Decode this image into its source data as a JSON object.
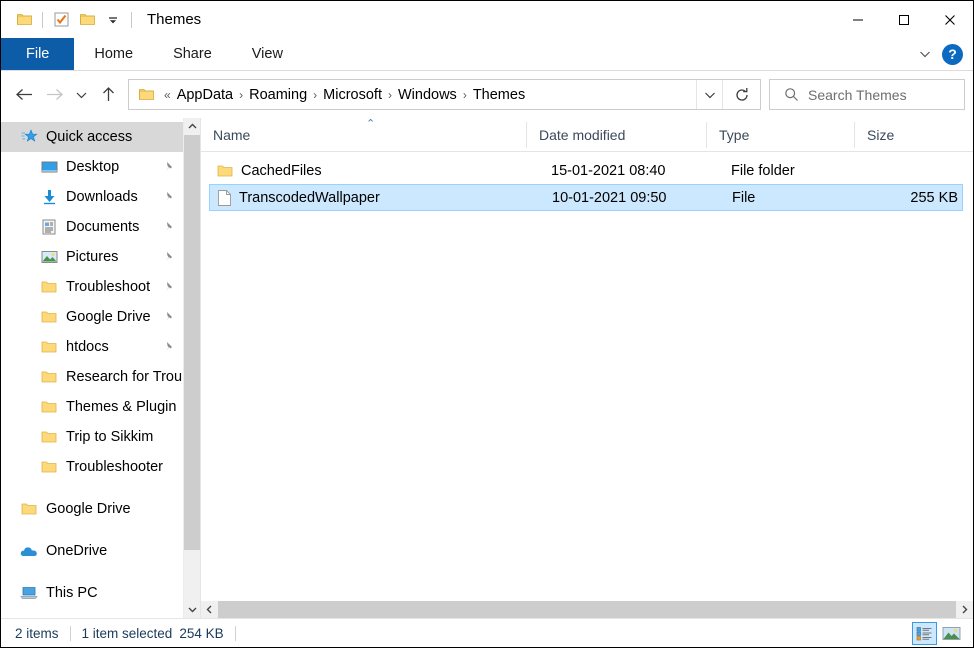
{
  "window": {
    "title": "Themes",
    "quick_access_toolbar": [
      {
        "name": "folder-icon",
        "label": "Properties"
      },
      {
        "name": "checkbox-icon",
        "label": "New folder"
      },
      {
        "name": "folder-icon",
        "label": "Folder"
      },
      {
        "name": "chevron-down-icon",
        "label": "Customize Quick Access Toolbar"
      }
    ],
    "controls": {
      "minimize": "Minimize",
      "maximize": "Maximize",
      "close": "Close"
    }
  },
  "ribbon": {
    "tabs": [
      {
        "label": "File",
        "active": true
      },
      {
        "label": "Home",
        "active": false
      },
      {
        "label": "Share",
        "active": false
      },
      {
        "label": "View",
        "active": false
      }
    ],
    "expand_label": "Expand the Ribbon",
    "help_label": "?"
  },
  "navigation": {
    "back": "Back",
    "forward": "Forward",
    "recent": "Recent locations",
    "up": "Up",
    "folder_icon": "folder-icon",
    "overflow": "«",
    "breadcrumbs": [
      "AppData",
      "Roaming",
      "Microsoft",
      "Windows",
      "Themes"
    ],
    "separator": "›",
    "dropdown": "Previous Locations",
    "refresh": "Refresh"
  },
  "search": {
    "placeholder": "Search Themes",
    "value": "",
    "icon": "search-icon"
  },
  "sidebar": {
    "items": [
      {
        "label": "Quick access",
        "icon": "quick-access-star-icon",
        "level": 0,
        "selected": true,
        "pinned": false
      },
      {
        "label": "Desktop",
        "icon": "desktop-icon",
        "level": 1,
        "selected": false,
        "pinned": true
      },
      {
        "label": "Downloads",
        "icon": "downloads-icon",
        "level": 1,
        "selected": false,
        "pinned": true
      },
      {
        "label": "Documents",
        "icon": "documents-icon",
        "level": 1,
        "selected": false,
        "pinned": true
      },
      {
        "label": "Pictures",
        "icon": "pictures-icon",
        "level": 1,
        "selected": false,
        "pinned": true
      },
      {
        "label": "Troubleshoot",
        "icon": "folder-icon",
        "level": 1,
        "selected": false,
        "pinned": true
      },
      {
        "label": "Google Drive",
        "icon": "folder-icon",
        "level": 1,
        "selected": false,
        "pinned": true
      },
      {
        "label": "htdocs",
        "icon": "folder-icon",
        "level": 1,
        "selected": false,
        "pinned": true
      },
      {
        "label": "Research for Trou",
        "icon": "folder-icon",
        "level": 1,
        "selected": false,
        "pinned": false
      },
      {
        "label": "Themes & Plugin",
        "icon": "folder-icon",
        "level": 1,
        "selected": false,
        "pinned": false
      },
      {
        "label": "Trip to Sikkim",
        "icon": "folder-icon",
        "level": 1,
        "selected": false,
        "pinned": false
      },
      {
        "label": "Troubleshooter",
        "icon": "folder-icon",
        "level": 1,
        "selected": false,
        "pinned": false
      },
      {
        "label": "Google Drive",
        "icon": "folder-icon",
        "level": 0,
        "selected": false,
        "pinned": false
      },
      {
        "label": "OneDrive",
        "icon": "onedrive-cloud-icon",
        "level": 0,
        "selected": false,
        "pinned": false
      },
      {
        "label": "This PC",
        "icon": "this-pc-icon",
        "level": 0,
        "selected": false,
        "pinned": false
      }
    ]
  },
  "filelist": {
    "columns": [
      {
        "key": "name",
        "label": "Name",
        "sorted": "asc"
      },
      {
        "key": "date",
        "label": "Date modified",
        "sorted": ""
      },
      {
        "key": "type",
        "label": "Type",
        "sorted": ""
      },
      {
        "key": "size",
        "label": "Size",
        "sorted": ""
      }
    ],
    "sort_caret": "⌃",
    "rows": [
      {
        "name": "CachedFiles",
        "date": "15-01-2021 08:40",
        "type": "File folder",
        "size": "",
        "icon": "folder-icon",
        "selected": false
      },
      {
        "name": "TranscodedWallpaper",
        "date": "10-01-2021 09:50",
        "type": "File",
        "size": "255 KB",
        "icon": "file-icon",
        "selected": true
      }
    ]
  },
  "statusbar": {
    "item_count": "2 items",
    "selection": "1 item selected",
    "selection_size": "254 KB",
    "views": [
      {
        "name": "details-view",
        "label": "Details view",
        "active": true
      },
      {
        "name": "large-icons-view",
        "label": "Large icons view",
        "active": false
      }
    ]
  },
  "colors": {
    "file_tab_blue": "#0c5ca8",
    "selection_blue": "#cce8ff",
    "selection_border": "#99d1ff",
    "sidebar_selected": "#d8d8d8",
    "folder_yellow": "#ffd96b",
    "status_text": "#1a3a5a"
  }
}
